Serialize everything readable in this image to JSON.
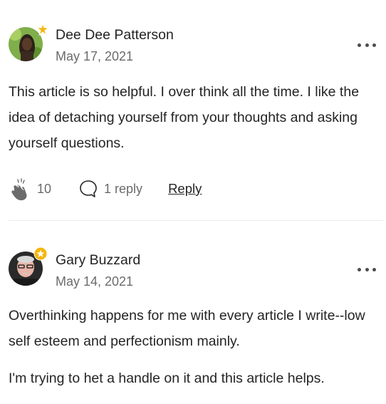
{
  "comments": [
    {
      "author": "Dee Dee Patterson",
      "date": "May 17, 2021",
      "paragraphs": [
        "This article is so helpful. I over think all the time. I like the idea of detaching yourself from your thoughts and asking yourself questions."
      ],
      "claps": "10",
      "replies": "1 reply",
      "reply_label": "Reply",
      "badge_color": "#f5b60b"
    },
    {
      "author": "Gary Buzzard",
      "date": "May 14, 2021",
      "paragraphs": [
        "Overthinking happens for me with every article I write--low self esteem and perfectionism mainly.",
        "I'm trying to het a handle on it and this article helps."
      ],
      "badge_color": "#f5b60b"
    }
  ],
  "icons": {
    "clap": "clap-icon",
    "reply": "reply-bubble-icon",
    "more": "more-options-icon",
    "badge": "star-badge-icon"
  },
  "colors": {
    "text": "#242424",
    "muted": "#6b6b6b",
    "divider": "#ececec",
    "badge": "#f5b60b"
  }
}
